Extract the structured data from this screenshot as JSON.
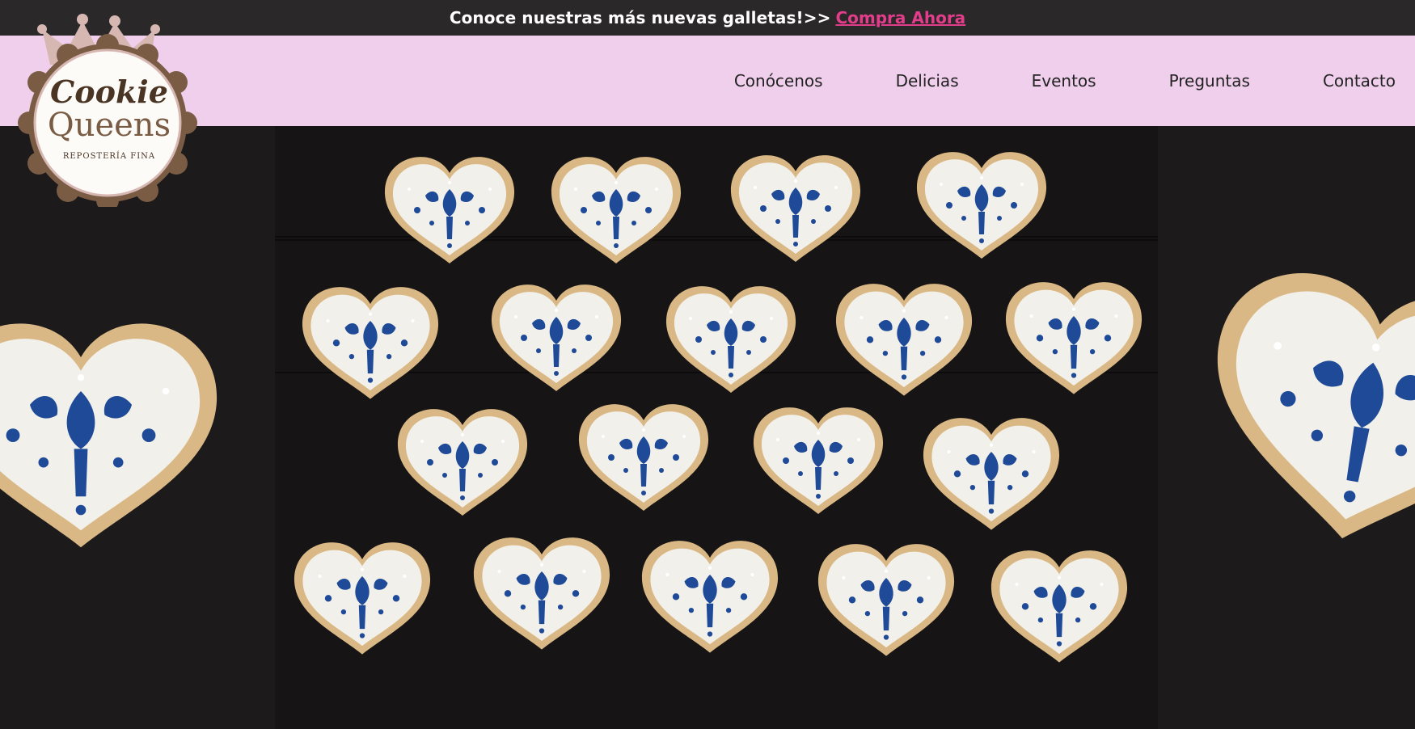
{
  "announcement": {
    "text": "Conoce nuestras más nuevas galletas!>>",
    "link_label": " Compra Ahora"
  },
  "brand": {
    "line1": "Cookie",
    "line2": "Queens",
    "tagline": "REPOSTERÍA FINA"
  },
  "nav": {
    "items": [
      "Conócenos",
      "Delicias",
      "Eventos",
      "Preguntas",
      "Contacto"
    ]
  },
  "colors": {
    "topbar": "#2a2828",
    "navbar": "#f0cfec",
    "link": "#e23d8a",
    "icing_blue": "#1f4a98"
  }
}
